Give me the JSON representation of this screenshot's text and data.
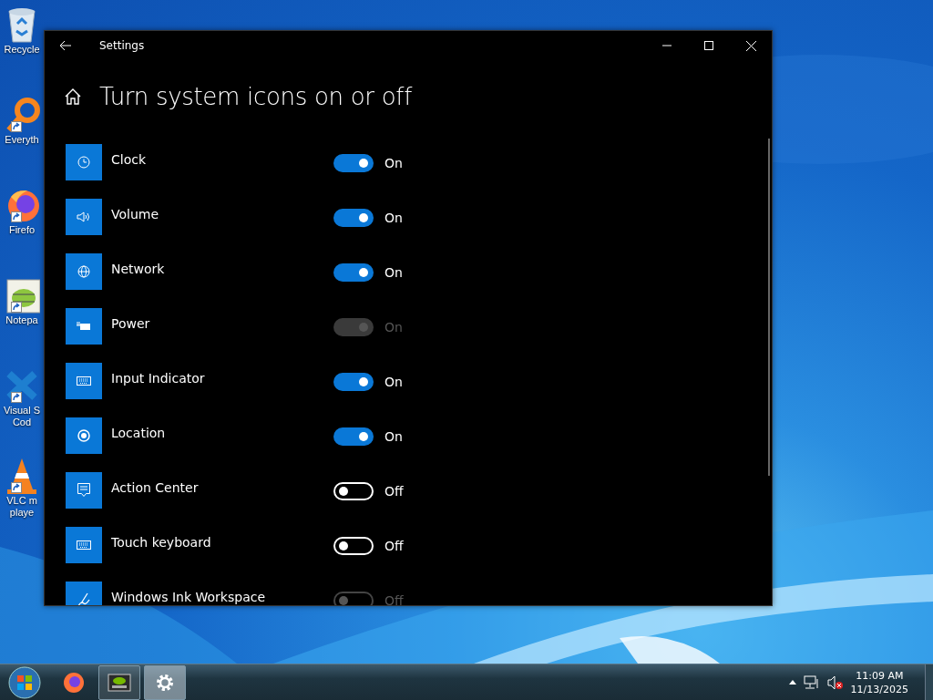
{
  "desktop_icons": [
    {
      "label": "Recycle",
      "shortcut": false
    },
    {
      "label": "Everyth",
      "shortcut": true
    },
    {
      "label": "Firefo",
      "shortcut": true
    },
    {
      "label": "Notepa",
      "shortcut": true
    },
    {
      "label": "Visual S\nCod",
      "shortcut": true
    },
    {
      "label": "VLC m\nplaye",
      "shortcut": true
    }
  ],
  "window": {
    "title": "Settings",
    "page_title": "Turn system icons on or off",
    "items": [
      {
        "label": "Clock",
        "on": true,
        "disabled": false,
        "state": "On"
      },
      {
        "label": "Volume",
        "on": true,
        "disabled": false,
        "state": "On"
      },
      {
        "label": "Network",
        "on": true,
        "disabled": false,
        "state": "On"
      },
      {
        "label": "Power",
        "on": true,
        "disabled": true,
        "state": "On"
      },
      {
        "label": "Input Indicator",
        "on": true,
        "disabled": false,
        "state": "On"
      },
      {
        "label": "Location",
        "on": true,
        "disabled": false,
        "state": "On"
      },
      {
        "label": "Action Center",
        "on": false,
        "disabled": false,
        "state": "Off"
      },
      {
        "label": "Touch keyboard",
        "on": false,
        "disabled": false,
        "state": "Off"
      },
      {
        "label": "Windows Ink Workspace",
        "on": false,
        "disabled": true,
        "state": "Off"
      }
    ]
  },
  "taskbar": {
    "apps": [
      {
        "running": false,
        "selected": false
      },
      {
        "running": true,
        "selected": false
      },
      {
        "running": true,
        "selected": true
      }
    ],
    "time": "11:09 AM",
    "date": "11/13/2025"
  }
}
